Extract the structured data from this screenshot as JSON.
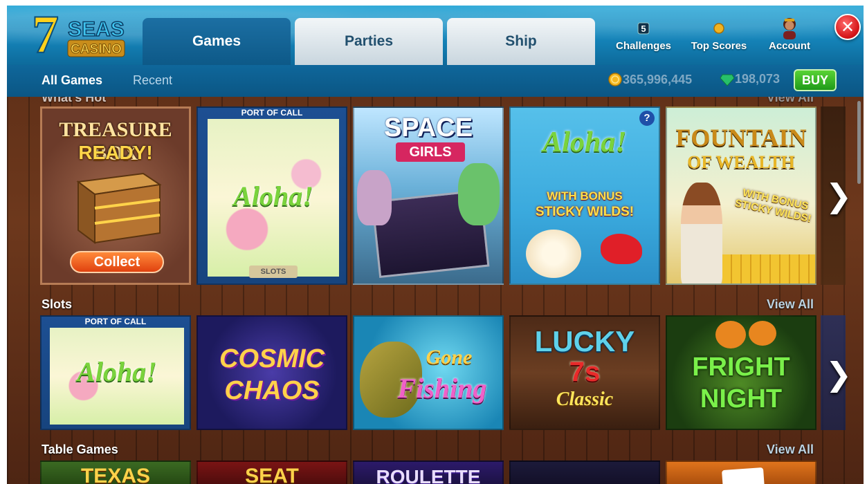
{
  "header": {
    "logo_number": "7",
    "logo_word1": "SEAS",
    "logo_word2": "CASINO",
    "tabs": [
      {
        "label": "Games"
      },
      {
        "label": "Parties"
      },
      {
        "label": "Ship"
      }
    ],
    "buttons": {
      "challenges": "Challenges",
      "challenges_badge": "5",
      "top_scores": "Top Scores",
      "account": "Account"
    },
    "close_label": "✕"
  },
  "subnav": {
    "all_games": "All Games",
    "recent": "Recent",
    "coins": "365,996,445",
    "gems": "198,073",
    "buy": "BUY"
  },
  "sections": {
    "hot": {
      "title": "What's Hot",
      "view_all": "View All"
    },
    "slots": {
      "title": "Slots",
      "view_all": "View All"
    },
    "table": {
      "title": "Table Games",
      "view_all": "View All"
    }
  },
  "hot_tiles": {
    "treasure": {
      "line1": "TREASURE BOX",
      "line2": "READY!",
      "button": "Collect"
    },
    "aloha1": {
      "banner": "PORT OF CALL",
      "title": "Aloha!",
      "tag": "SLOTS"
    },
    "space": {
      "line1": "SPACE",
      "line2": "GIRLS"
    },
    "aloha2": {
      "title": "Aloha!",
      "sub1": "WITH BONUS",
      "sub2": "STICKY WILDS!",
      "help": "?"
    },
    "fountain": {
      "line1": "FOUNTAIN",
      "line2": "OF WEALTH",
      "sub1": "WITH BONUS",
      "sub2": "STICKY WILDS!"
    }
  },
  "slot_tiles": {
    "aloha": {
      "banner": "PORT OF CALL",
      "title": "Aloha!"
    },
    "cosmic": {
      "line1": "COSMIC",
      "line2": "CHAOS"
    },
    "fishing": {
      "line1": "Gone",
      "line2": "Fishing"
    },
    "lucky": {
      "line1": "LUCKY",
      "line2": "7s",
      "line3": "Classic"
    },
    "fright": {
      "line1": "FRIGHT",
      "line2": "NIGHT"
    }
  },
  "table_tiles": {
    "texas": "TEXAS",
    "seat": "SEAT",
    "roulette": "ROULETTE"
  },
  "colors": {
    "ocean": "#1584b9",
    "wood": "#5a2c16",
    "buy_green": "#2fb024",
    "close_red": "#d6161a"
  }
}
